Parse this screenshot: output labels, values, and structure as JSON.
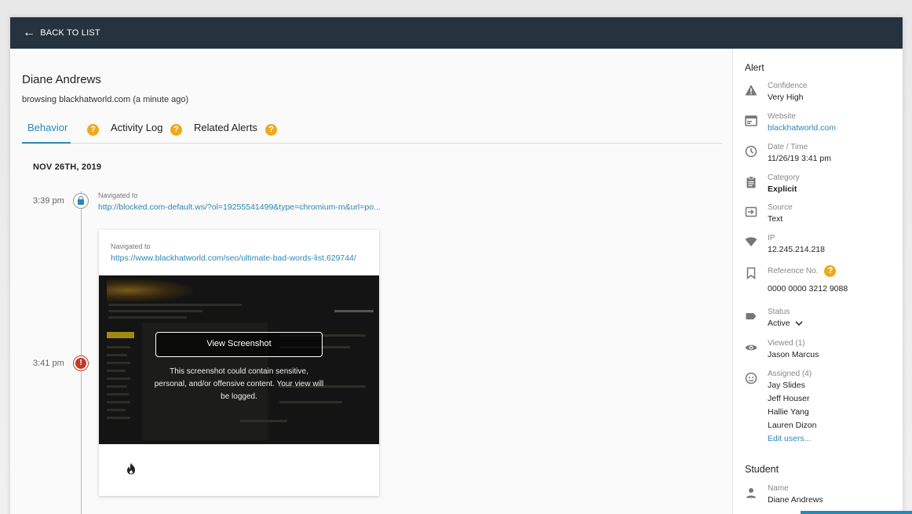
{
  "topbar": {
    "back_label": "BACK TO LIST"
  },
  "user": {
    "name": "Diane Andrews",
    "subtitle": "browsing blackhatworld.com (a minute ago)"
  },
  "tabs": [
    {
      "label": "Behavior",
      "help": "?"
    },
    {
      "label": "Activity Log",
      "help": "?"
    },
    {
      "label": "Related Alerts",
      "help": "?"
    }
  ],
  "timeline": {
    "date": "NOV 26TH, 2019",
    "events": [
      {
        "time": "3:39 pm",
        "label": "Navigated to",
        "url": "http://blocked.com-default.ws/?ol=19255541499&type=chromium-m&url=po..."
      },
      {
        "time": "3:41 pm",
        "label": "Navigated to",
        "url": "https://www.blackhatworld.com/seo/ultimate-bad-words-list.629744/",
        "view_button": "View Screenshot",
        "warning": "This screenshot could contain sensitive, personal, and/or offensive content. Your view will be logged."
      }
    ]
  },
  "alert": {
    "title": "Alert",
    "confidence": {
      "label": "Confidence",
      "value": "Very High"
    },
    "website": {
      "label": "Website",
      "value": "blackhatworld.com"
    },
    "datetime": {
      "label": "Date / Time",
      "value": "11/26/19 3:41 pm"
    },
    "category": {
      "label": "Category",
      "value": "Explicit"
    },
    "source": {
      "label": "Source",
      "value": "Text"
    },
    "ip": {
      "label": "IP",
      "value": "12.245.214.218"
    },
    "reference": {
      "label": "Reference No.",
      "value": "0000 0000 3212 9088",
      "help": "?"
    },
    "status": {
      "label": "Status",
      "value": "Active"
    },
    "viewed": {
      "label": "Viewed (1)",
      "value": "Jason Marcus"
    },
    "assigned": {
      "label": "Assigned (4)",
      "users": [
        "Jay Slides",
        "Jeff Houser",
        "Hallie Yang",
        "Lauren Dizon"
      ],
      "edit_label": "Edit users..."
    }
  },
  "student": {
    "title": "Student",
    "name": {
      "label": "Name",
      "value": "Diane Andrews"
    }
  },
  "colors": {
    "topbar": "#24333d",
    "accent": "#2a88b5",
    "help": "#f0a819",
    "alert": "#c0392b"
  }
}
